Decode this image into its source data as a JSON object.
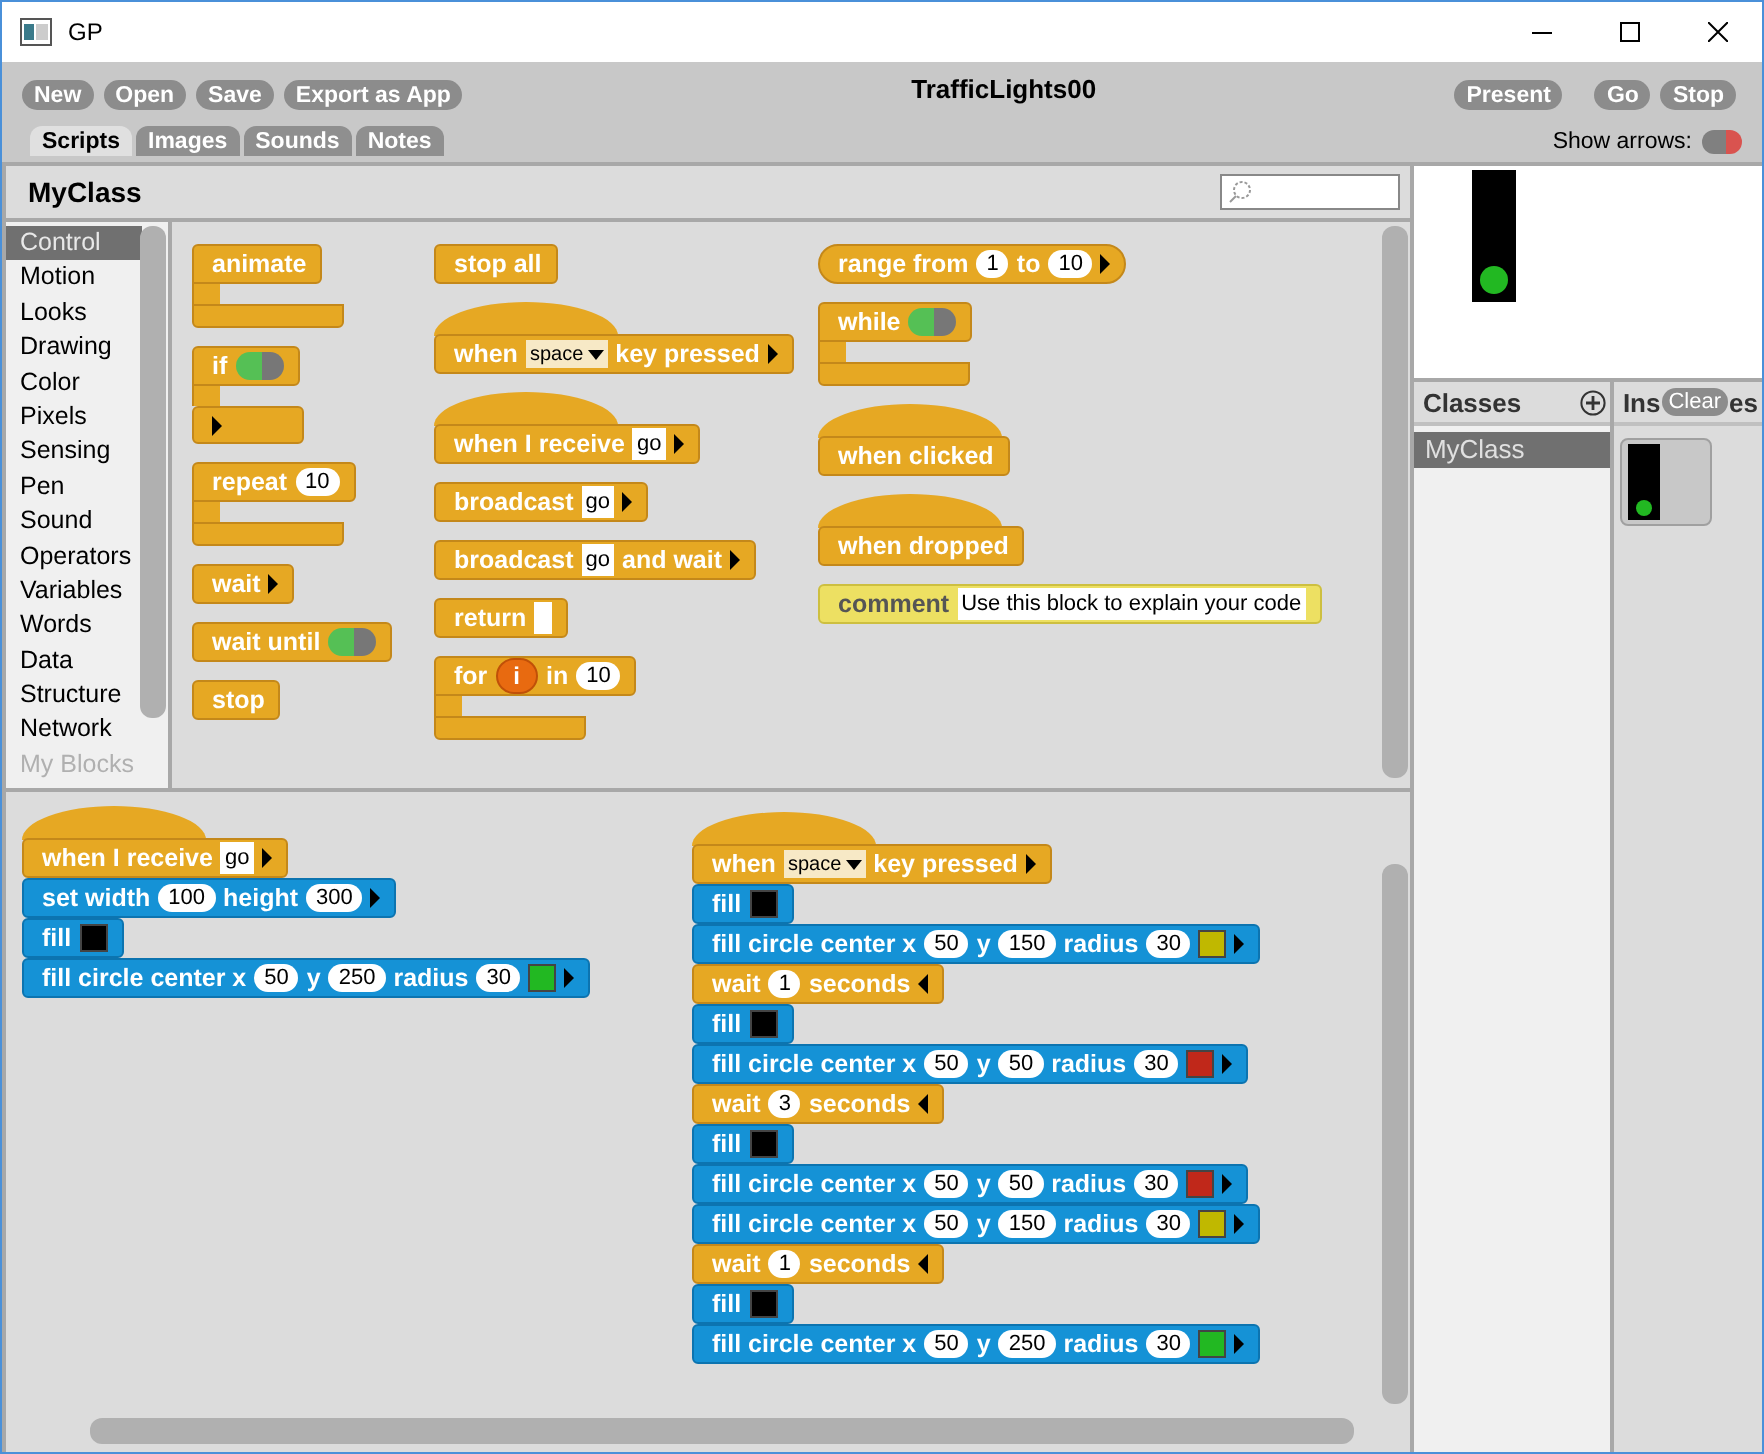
{
  "window": {
    "title": "GP"
  },
  "toolbar": {
    "left_buttons": [
      "New",
      "Open",
      "Save",
      "Export as App"
    ],
    "project_title": "TrafficLights00",
    "right_buttons": [
      "Present",
      "Go",
      "Stop"
    ]
  },
  "tabs": [
    {
      "label": "Scripts",
      "selected": true
    },
    {
      "label": "Images",
      "selected": false
    },
    {
      "label": "Sounds",
      "selected": false
    },
    {
      "label": "Notes",
      "selected": false
    }
  ],
  "show_arrows": {
    "label": "Show arrows:",
    "on": false
  },
  "class_header": {
    "title": "MyClass"
  },
  "categories": [
    {
      "label": "Control",
      "selected": true,
      "disabled": false
    },
    {
      "label": "Motion",
      "selected": false,
      "disabled": false
    },
    {
      "label": "Looks",
      "selected": false,
      "disabled": false
    },
    {
      "label": "Drawing",
      "selected": false,
      "disabled": false
    },
    {
      "label": "Color",
      "selected": false,
      "disabled": false
    },
    {
      "label": "Pixels",
      "selected": false,
      "disabled": false
    },
    {
      "label": "Sensing",
      "selected": false,
      "disabled": false
    },
    {
      "label": "Pen",
      "selected": false,
      "disabled": false
    },
    {
      "label": "Sound",
      "selected": false,
      "disabled": false
    },
    {
      "label": "Operators",
      "selected": false,
      "disabled": false
    },
    {
      "label": "Variables",
      "selected": false,
      "disabled": false
    },
    {
      "label": "Words",
      "selected": false,
      "disabled": false
    },
    {
      "label": "Data",
      "selected": false,
      "disabled": false
    },
    {
      "label": "Structure",
      "selected": false,
      "disabled": false
    },
    {
      "label": "Network",
      "selected": false,
      "disabled": false
    },
    {
      "label": "My Blocks",
      "selected": false,
      "disabled": true
    }
  ],
  "palette": {
    "columns": [
      [
        {
          "kind": "c",
          "color": "#e6a823",
          "parts": [
            {
              "kind": "label",
              "text": "animate"
            }
          ]
        },
        {
          "kind": "c",
          "color": "#e6a823",
          "parts": [
            {
              "kind": "label",
              "text": "if"
            },
            {
              "kind": "toggle",
              "on": true
            }
          ],
          "footer": [
            {
              "kind": "expand"
            }
          ]
        },
        {
          "kind": "c",
          "color": "#e6a823",
          "parts": [
            {
              "kind": "label",
              "text": "repeat"
            },
            {
              "kind": "number",
              "text": "10"
            }
          ]
        },
        {
          "kind": "command",
          "color": "#e6a823",
          "parts": [
            {
              "kind": "label",
              "text": "wait"
            },
            {
              "kind": "expand"
            }
          ]
        },
        {
          "kind": "command",
          "color": "#e6a823",
          "parts": [
            {
              "kind": "label",
              "text": "wait until"
            },
            {
              "kind": "toggle",
              "on": true
            }
          ]
        },
        {
          "kind": "command",
          "color": "#e6a823",
          "parts": [
            {
              "kind": "label",
              "text": "stop"
            }
          ]
        }
      ],
      [
        {
          "kind": "command",
          "color": "#e6a823",
          "parts": [
            {
              "kind": "label",
              "text": "stop all"
            }
          ]
        },
        {
          "kind": "hat",
          "color": "#e6a823",
          "parts": [
            {
              "kind": "label",
              "text": "when"
            },
            {
              "kind": "menu",
              "text": "space"
            },
            {
              "kind": "label",
              "text": "key pressed"
            },
            {
              "kind": "expand"
            }
          ]
        },
        {
          "kind": "hat",
          "color": "#e6a823",
          "parts": [
            {
              "kind": "label",
              "text": "when I receive"
            },
            {
              "kind": "slot",
              "text": "go"
            },
            {
              "kind": "expand"
            }
          ]
        },
        {
          "kind": "command",
          "color": "#e6a823",
          "parts": [
            {
              "kind": "label",
              "text": "broadcast"
            },
            {
              "kind": "slot",
              "text": "go"
            },
            {
              "kind": "expand"
            }
          ]
        },
        {
          "kind": "command",
          "color": "#e6a823",
          "parts": [
            {
              "kind": "label",
              "text": "broadcast"
            },
            {
              "kind": "slot",
              "text": "go"
            },
            {
              "kind": "label",
              "text": "and wait"
            },
            {
              "kind": "expand"
            }
          ]
        },
        {
          "kind": "command",
          "color": "#e6a823",
          "parts": [
            {
              "kind": "label",
              "text": "return"
            },
            {
              "kind": "empty-slot"
            }
          ]
        },
        {
          "kind": "c",
          "color": "#e6a823",
          "parts": [
            {
              "kind": "label",
              "text": "for"
            },
            {
              "kind": "var",
              "text": "i"
            },
            {
              "kind": "label",
              "text": "in"
            },
            {
              "kind": "number",
              "text": "10"
            }
          ]
        }
      ],
      [
        {
          "kind": "reporter",
          "color": "#e6a823",
          "parts": [
            {
              "kind": "label",
              "text": "range from"
            },
            {
              "kind": "number",
              "text": "1"
            },
            {
              "kind": "label",
              "text": "to"
            },
            {
              "kind": "number",
              "text": "10"
            },
            {
              "kind": "expand"
            }
          ]
        },
        {
          "kind": "c",
          "color": "#e6a823",
          "parts": [
            {
              "kind": "label",
              "text": "while"
            },
            {
              "kind": "toggle",
              "on": true
            }
          ]
        },
        {
          "kind": "hat",
          "color": "#e6a823",
          "parts": [
            {
              "kind": "label",
              "text": "when clicked"
            }
          ]
        },
        {
          "kind": "hat",
          "color": "#e6a823",
          "parts": [
            {
              "kind": "label",
              "text": "when dropped"
            }
          ]
        },
        {
          "kind": "comment",
          "color": "#ede062",
          "parts": [
            {
              "kind": "label",
              "text": "comment"
            },
            {
              "kind": "note",
              "text": "Use this block to explain your code"
            }
          ]
        }
      ]
    ]
  },
  "scripts": [
    {
      "blocks": [
        {
          "kind": "hat",
          "color": "#e6a823",
          "parts": [
            {
              "kind": "label",
              "text": "when I receive"
            },
            {
              "kind": "slot",
              "text": "go"
            },
            {
              "kind": "expand"
            }
          ]
        },
        {
          "kind": "command",
          "color": "#1592d6",
          "parts": [
            {
              "kind": "label",
              "text": "set width"
            },
            {
              "kind": "number",
              "text": "100"
            },
            {
              "kind": "label",
              "text": "height"
            },
            {
              "kind": "number",
              "text": "300"
            },
            {
              "kind": "expand"
            }
          ]
        },
        {
          "kind": "command",
          "color": "#1592d6",
          "parts": [
            {
              "kind": "label",
              "text": "fill"
            },
            {
              "kind": "color",
              "color": "#000000"
            }
          ]
        },
        {
          "kind": "command",
          "color": "#1592d6",
          "parts": [
            {
              "kind": "label",
              "text": "fill circle center x"
            },
            {
              "kind": "number",
              "text": "50"
            },
            {
              "kind": "label",
              "text": "y"
            },
            {
              "kind": "number",
              "text": "250"
            },
            {
              "kind": "label",
              "text": "radius"
            },
            {
              "kind": "number",
              "text": "30"
            },
            {
              "kind": "color",
              "color": "#22b822"
            },
            {
              "kind": "expand"
            }
          ]
        }
      ]
    },
    {
      "blocks": [
        {
          "kind": "hat",
          "color": "#e6a823",
          "parts": [
            {
              "kind": "label",
              "text": "when"
            },
            {
              "kind": "menu",
              "text": "space"
            },
            {
              "kind": "label",
              "text": "key pressed"
            },
            {
              "kind": "expand"
            }
          ]
        },
        {
          "kind": "command",
          "color": "#1592d6",
          "parts": [
            {
              "kind": "label",
              "text": "fill"
            },
            {
              "kind": "color",
              "color": "#000000"
            }
          ]
        },
        {
          "kind": "command",
          "color": "#1592d6",
          "parts": [
            {
              "kind": "label",
              "text": "fill circle center x"
            },
            {
              "kind": "number",
              "text": "50"
            },
            {
              "kind": "label",
              "text": "y"
            },
            {
              "kind": "number",
              "text": "150"
            },
            {
              "kind": "label",
              "text": "radius"
            },
            {
              "kind": "number",
              "text": "30"
            },
            {
              "kind": "color",
              "color": "#c0b800"
            },
            {
              "kind": "expand"
            }
          ]
        },
        {
          "kind": "command",
          "color": "#e6a823",
          "parts": [
            {
              "kind": "label",
              "text": "wait"
            },
            {
              "kind": "number",
              "text": "1"
            },
            {
              "kind": "label",
              "text": "seconds"
            },
            {
              "kind": "collapse"
            }
          ]
        },
        {
          "kind": "command",
          "color": "#1592d6",
          "parts": [
            {
              "kind": "label",
              "text": "fill"
            },
            {
              "kind": "color",
              "color": "#000000"
            }
          ]
        },
        {
          "kind": "command",
          "color": "#1592d6",
          "parts": [
            {
              "kind": "label",
              "text": "fill circle center x"
            },
            {
              "kind": "number",
              "text": "50"
            },
            {
              "kind": "label",
              "text": "y"
            },
            {
              "kind": "number",
              "text": "50"
            },
            {
              "kind": "label",
              "text": "radius"
            },
            {
              "kind": "number",
              "text": "30"
            },
            {
              "kind": "color",
              "color": "#c0281a"
            },
            {
              "kind": "expand"
            }
          ]
        },
        {
          "kind": "command",
          "color": "#e6a823",
          "parts": [
            {
              "kind": "label",
              "text": "wait"
            },
            {
              "kind": "number",
              "text": "3"
            },
            {
              "kind": "label",
              "text": "seconds"
            },
            {
              "kind": "collapse"
            }
          ]
        },
        {
          "kind": "command",
          "color": "#1592d6",
          "parts": [
            {
              "kind": "label",
              "text": "fill"
            },
            {
              "kind": "color",
              "color": "#000000"
            }
          ]
        },
        {
          "kind": "command",
          "color": "#1592d6",
          "parts": [
            {
              "kind": "label",
              "text": "fill circle center x"
            },
            {
              "kind": "number",
              "text": "50"
            },
            {
              "kind": "label",
              "text": "y"
            },
            {
              "kind": "number",
              "text": "50"
            },
            {
              "kind": "label",
              "text": "radius"
            },
            {
              "kind": "number",
              "text": "30"
            },
            {
              "kind": "color",
              "color": "#c0281a"
            },
            {
              "kind": "expand"
            }
          ]
        },
        {
          "kind": "command",
          "color": "#1592d6",
          "parts": [
            {
              "kind": "label",
              "text": "fill circle center x"
            },
            {
              "kind": "number",
              "text": "50"
            },
            {
              "kind": "label",
              "text": "y"
            },
            {
              "kind": "number",
              "text": "150"
            },
            {
              "kind": "label",
              "text": "radius"
            },
            {
              "kind": "number",
              "text": "30"
            },
            {
              "kind": "color",
              "color": "#c0b800"
            },
            {
              "kind": "expand"
            }
          ]
        },
        {
          "kind": "command",
          "color": "#e6a823",
          "parts": [
            {
              "kind": "label",
              "text": "wait"
            },
            {
              "kind": "number",
              "text": "1"
            },
            {
              "kind": "label",
              "text": "seconds"
            },
            {
              "kind": "collapse"
            }
          ]
        },
        {
          "kind": "command",
          "color": "#1592d6",
          "parts": [
            {
              "kind": "label",
              "text": "fill"
            },
            {
              "kind": "color",
              "color": "#000000"
            }
          ]
        },
        {
          "kind": "command",
          "color": "#1592d6",
          "parts": [
            {
              "kind": "label",
              "text": "fill circle center x"
            },
            {
              "kind": "number",
              "text": "50"
            },
            {
              "kind": "label",
              "text": "y"
            },
            {
              "kind": "number",
              "text": "250"
            },
            {
              "kind": "label",
              "text": "radius"
            },
            {
              "kind": "number",
              "text": "30"
            },
            {
              "kind": "color",
              "color": "#22b822"
            },
            {
              "kind": "expand"
            }
          ]
        }
      ]
    }
  ],
  "classes": {
    "title": "Classes",
    "items": [
      {
        "label": "MyClass",
        "selected": true
      }
    ]
  },
  "instances": {
    "title_parts": [
      "Ins",
      "es"
    ],
    "clear_button": "Clear"
  }
}
